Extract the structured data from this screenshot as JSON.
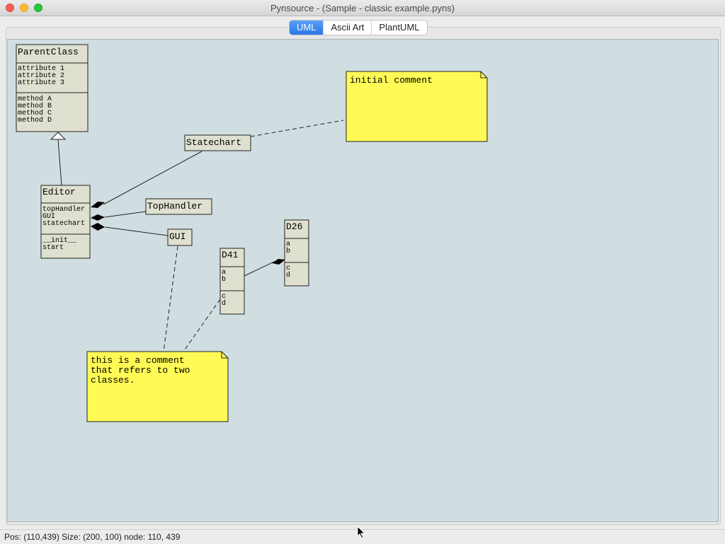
{
  "window": {
    "title": "Pynsource - (Sample - classic example.pyns)"
  },
  "tabs": [
    {
      "label": "UML",
      "active": true
    },
    {
      "label": "Ascii Art",
      "active": false
    },
    {
      "label": "PlantUML",
      "active": false
    }
  ],
  "diagram": {
    "classes": {
      "parent": {
        "name": "ParentClass",
        "attributes": [
          "attribute 1",
          "attribute 2",
          "attribute 3"
        ],
        "methods": [
          "method A",
          "method B",
          "method C",
          "method D"
        ]
      },
      "editor": {
        "name": "Editor",
        "attributes": [
          "topHandler",
          "GUI",
          "statechart"
        ],
        "methods": [
          "__init__",
          "start"
        ]
      },
      "statechart": {
        "name": "Statechart"
      },
      "tophandler": {
        "name": "TopHandler"
      },
      "gui": {
        "name": "GUI"
      },
      "d41": {
        "name": "D41",
        "attributes": [
          "a",
          "b"
        ],
        "methods": [
          "c",
          "d"
        ]
      },
      "d26": {
        "name": "D26",
        "attributes": [
          "a",
          "b"
        ],
        "methods": [
          "c",
          "d"
        ]
      }
    },
    "comments": {
      "initial": {
        "lines": [
          "initial comment"
        ]
      },
      "two": {
        "lines": [
          "this is a comment",
          "that refers to two",
          "classes."
        ]
      }
    },
    "colors": {
      "canvas": "#d0dee1",
      "class_fill": "#e0e0d0",
      "comment_fill": "#fffa55",
      "line": "#222222"
    }
  },
  "status": {
    "text": "Pos: (110,439)  Size: (200, 100) node: 110, 439"
  }
}
